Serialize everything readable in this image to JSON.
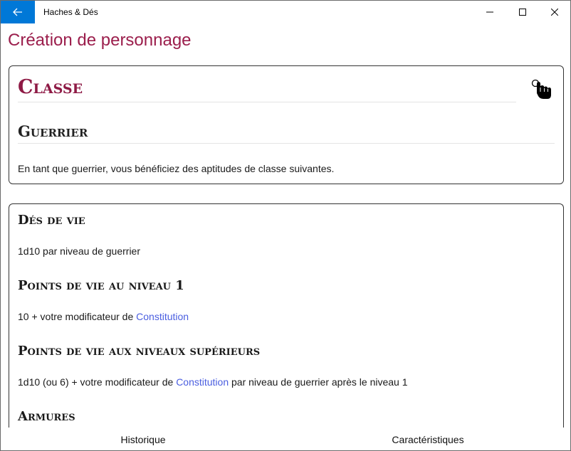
{
  "window": {
    "app_title": "Haches & Dés",
    "icons": {
      "back": "arrow-left-icon",
      "minimize": "minimize-icon",
      "maximize": "maximize-icon",
      "close": "close-icon"
    }
  },
  "page": {
    "title": "Création de personnage"
  },
  "class_card": {
    "heading": "Classe",
    "cursor_icon": "hand-pointer-icon",
    "class_name": "Guerrier",
    "description": "En tant que guerrier, vous bénéficiez des aptitudes de classe suivantes."
  },
  "features": {
    "hit_dice": {
      "heading": "Dés de vie",
      "text": "1d10 par niveau de guerrier"
    },
    "hp_level1": {
      "heading": "Points de vie au niveau 1",
      "text_before": "10 + votre modificateur de ",
      "link": "Constitution"
    },
    "hp_higher": {
      "heading": "Points de vie aux niveaux supérieurs",
      "text_before": "1d10 (ou 6) + votre modificateur de ",
      "link": "Constitution",
      "text_after": " par niveau de guerrier après le niveau 1"
    },
    "armor": {
      "heading": "Armures"
    }
  },
  "bottom_nav": {
    "prev": "Historique",
    "next": "Caractéristiques"
  }
}
